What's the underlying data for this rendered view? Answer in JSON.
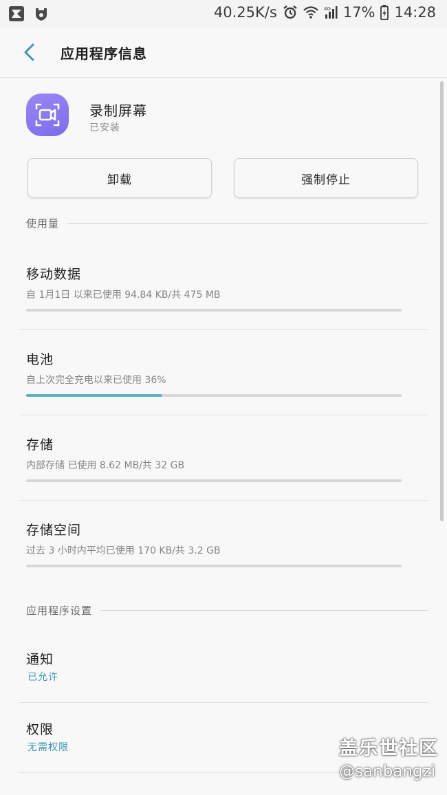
{
  "status_bar": {
    "speed": "40.25K/s",
    "battery": "17%",
    "time": "14:28"
  },
  "app_bar": {
    "title": "应用程序信息"
  },
  "app": {
    "name": "录制屏幕",
    "status": "已安装",
    "icon_color": "#8a78f0"
  },
  "buttons": {
    "uninstall": "卸载",
    "force_stop": "强制停止"
  },
  "usage": {
    "header": "使用量",
    "items": [
      {
        "title": "移动数据",
        "subtitle": "自 1月1日 以来已使用 94.84 KB/共 475 MB",
        "progress": 0
      },
      {
        "title": "电池",
        "subtitle": "自上次完全充电以来已使用 36%",
        "progress": 36
      },
      {
        "title": "存储",
        "subtitle": "内部存储 已使用 8.62 MB/共 32 GB",
        "progress": 0
      },
      {
        "title": "存储空间",
        "subtitle": "过去 3 小时内平均已使用 170 KB/共 3.2 GB",
        "progress": 0
      }
    ]
  },
  "settings": {
    "header": "应用程序设置",
    "items": [
      {
        "title": "通知",
        "subtitle": "已允许"
      },
      {
        "title": "权限",
        "subtitle": "无需权限"
      }
    ]
  },
  "watermark": {
    "line1": "盖乐世社区",
    "line2": "@sanbangzi"
  },
  "colors": {
    "accent": "#5eb1c3",
    "link": "#3b97b9",
    "background": "#f8f8f8"
  }
}
